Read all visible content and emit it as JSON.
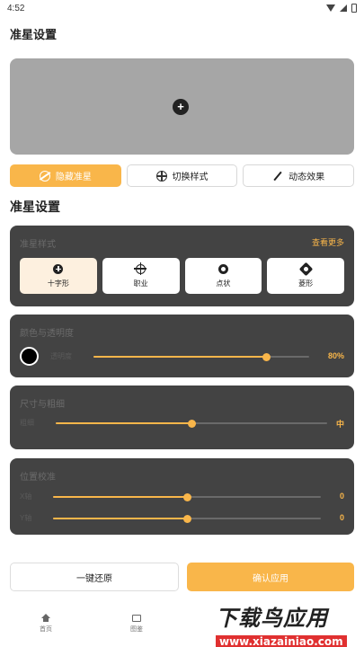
{
  "status_bar": {
    "time": "4:52"
  },
  "header": {
    "title": "准星设置"
  },
  "preview": {
    "crosshair_glyph": "+"
  },
  "actions": [
    {
      "label": "隐藏准星",
      "icon": "eye-off-icon",
      "active": true
    },
    {
      "label": "切换样式",
      "icon": "crosshair-icon",
      "active": false
    },
    {
      "label": "动态效果",
      "icon": "magic-wand-icon",
      "active": false
    }
  ],
  "section_title": "准星设置",
  "style_card": {
    "title": "准星样式",
    "more_link": "查看更多",
    "items": [
      {
        "label": "十字形",
        "icon": "plus-circle-icon",
        "selected": true
      },
      {
        "label": "职业",
        "icon": "crosshair-target-icon",
        "selected": false
      },
      {
        "label": "点状",
        "icon": "ring-dot-icon",
        "selected": false
      },
      {
        "label": "菱形",
        "icon": "diamond-icon",
        "selected": false
      }
    ]
  },
  "color_card": {
    "title": "颜色与透明度",
    "row_label": "透明度",
    "swatch_color": "#000000",
    "opacity_fraction": 0.8,
    "value": "80%"
  },
  "size_card": {
    "title": "尺寸与粗细",
    "row_label": "粗细",
    "level_fraction": 0.5,
    "value": "中"
  },
  "position_card": {
    "title": "位置校准",
    "rows": [
      {
        "label": "X轴",
        "level_fraction": 0.5,
        "value": "0"
      },
      {
        "label": "Y轴",
        "level_fraction": 0.5,
        "value": "0"
      }
    ]
  },
  "bottom_actions": {
    "reset_label": "一键还原",
    "apply_label": "确认应用"
  },
  "tab_bar": [
    {
      "label": "首页",
      "icon": "home-icon"
    },
    {
      "label": "图鉴",
      "icon": "image-icon"
    }
  ],
  "watermark": {
    "brand": "下载鸟应用",
    "url": "www.xiazainiao.com"
  },
  "colors": {
    "accent": "#f9b64a",
    "card_bg": "#434343",
    "preview_bg": "#a6a6a6"
  }
}
